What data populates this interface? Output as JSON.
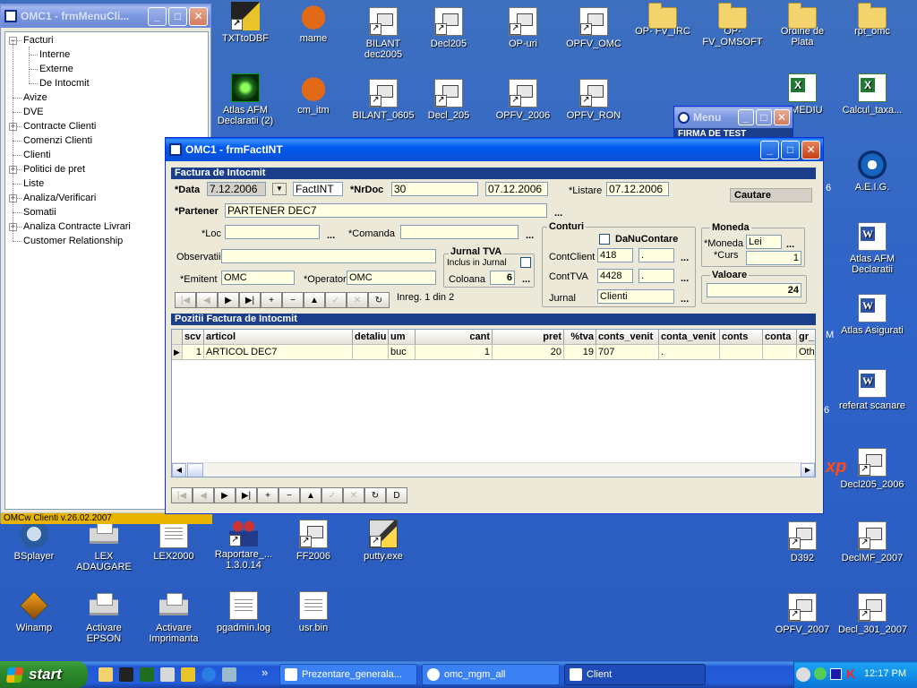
{
  "desktop": {
    "icons": [
      {
        "label": "TXTtoDBF",
        "type": "txt7"
      },
      {
        "label": "mame",
        "type": "fox"
      },
      {
        "label": "BILANT dec2005",
        "type": "flag"
      },
      {
        "label": "Decl205",
        "type": "flag"
      },
      {
        "label": "OP-uri",
        "type": "flag"
      },
      {
        "label": "OPFV_OMC",
        "type": "flag"
      },
      {
        "label": "OP- FV_IRC",
        "type": "folder"
      },
      {
        "label": "OP- FV_OMSOFT",
        "type": "folder"
      },
      {
        "label": "Ordine de Plata",
        "type": "folder"
      },
      {
        "label": "rpt_omc",
        "type": "folder"
      },
      {
        "label": "Atlas AFM Declaratii (2)",
        "type": "atlas"
      },
      {
        "label": "cm_itm",
        "type": "fox"
      },
      {
        "label": "BILANT_0605",
        "type": "flag"
      },
      {
        "label": "Decl_205",
        "type": "flag"
      },
      {
        "label": "OPFV_2006",
        "type": "flag"
      },
      {
        "label": "OPFV_RON",
        "type": "flag"
      },
      {
        "label": "A MEDIU",
        "type": "excel"
      },
      {
        "label": "Calcul_taxa...",
        "type": "excel"
      },
      {
        "label": "A.E.I.G.",
        "type": "gear"
      },
      {
        "label": "Atlas AFM Declaratii",
        "type": "word"
      },
      {
        "label": "Atlas Asigurati",
        "type": "word"
      },
      {
        "label": "referat scanare",
        "type": "word"
      },
      {
        "label": "Decl205_2006",
        "type": "flag"
      },
      {
        "label": "BSplayer",
        "type": "bs"
      },
      {
        "label": "LEX ADAUGARE",
        "type": "printer"
      },
      {
        "label": "LEX2000",
        "type": "doc"
      },
      {
        "label": "Raportare_... 1.3.0.14",
        "type": "people"
      },
      {
        "label": "FF2006",
        "type": "flag"
      },
      {
        "label": "putty.exe",
        "type": "putty"
      },
      {
        "label": "D392",
        "type": "flag"
      },
      {
        "label": "DeclMF_2007",
        "type": "flag"
      },
      {
        "label": "Winamp",
        "type": "winamp"
      },
      {
        "label": "Activare EPSON",
        "type": "printer"
      },
      {
        "label": "Activare Imprimanta",
        "type": "printer"
      },
      {
        "label": "pgadmin.log",
        "type": "doc"
      },
      {
        "label": "usr.bin",
        "type": "doc"
      },
      {
        "label": "OPFV_2007",
        "type": "flag"
      },
      {
        "label": "Decl_301_2007",
        "type": "flag"
      }
    ],
    "partial_fragments": {
      "six_a": "6",
      "six_b": "6",
      "m": "M",
      "xp": "xp"
    }
  },
  "menu_window": {
    "title": "OMC1 - frmMenuCli...",
    "tree": [
      {
        "label": "Facturi",
        "expander": "−"
      },
      {
        "label": "Interne"
      },
      {
        "label": "Externe"
      },
      {
        "label": "De Intocmit"
      },
      {
        "label": "Avize"
      },
      {
        "label": "DVE"
      },
      {
        "label": "Contracte Clienti",
        "expander": "+"
      },
      {
        "label": "Comenzi Clienti"
      },
      {
        "label": "Clienti"
      },
      {
        "label": "Politici de pret",
        "expander": "+"
      },
      {
        "label": "Liste"
      },
      {
        "label": "Analiza/Verificari",
        "expander": "+"
      },
      {
        "label": "Somatii"
      },
      {
        "label": "Analiza Contracte Livrari",
        "expander": "+"
      },
      {
        "label": "Customer Relationship"
      }
    ],
    "status": "OMCw Clienti v.26.02.2007"
  },
  "mini_menu": {
    "title": "Menu",
    "strip": "FIRMA DE TEST"
  },
  "form_window": {
    "title": "OMC1 - frmFactINT",
    "section_header": "Factura de Intocmit",
    "data_label": "*Data",
    "data_value": "7.12.2006",
    "dropdown_glyph": "▼",
    "doc_type": "FactINT",
    "nrdoc_label": "*NrDoc",
    "nrdoc_value": "30",
    "nrdoc_date": "07.12.2006",
    "listare_label": "*Listare",
    "listare_value": "07.12.2006",
    "cautare": "Cautare",
    "partener_label": "*Partener",
    "partener_value": "PARTENER DEC7",
    "loc_label": "*Loc",
    "loc_value": "",
    "comanda_label": "*Comanda",
    "comanda_value": "",
    "observatii_label": "Observatii",
    "observatii_value": "",
    "emitent_label": "*Emitent",
    "emitent_value": "OMC",
    "operator_label": "*Operator",
    "operator_value": "OMC",
    "ellipsis": "...",
    "jurnal_tva": {
      "title": "Jurnal TVA",
      "inclus_label": "Inclus in Jurnal",
      "coloana_label": "Coloana",
      "coloana_value": "6"
    },
    "conturi": {
      "title": "Conturi",
      "danucontare": "DaNuContare",
      "contclient_label": "ContClient",
      "contclient_value": "418",
      "contclient_sub": ".",
      "conttva_label": "ContTVA",
      "conttva_value": "4428",
      "conttva_sub": ".",
      "jurnal_label": "Jurnal",
      "jurnal_value": "Clienti"
    },
    "moneda": {
      "title": "Moneda",
      "moneda_label": "*Moneda",
      "moneda_value": "Lei",
      "curs_label": "*Curs",
      "curs_value": "1"
    },
    "valoare": {
      "title": "Valoare",
      "value": "24"
    },
    "nav_top": {
      "icons": [
        "|◀",
        "◀",
        "▶",
        "▶|",
        "+",
        "−",
        "▲",
        "✓",
        "✕",
        "↻"
      ],
      "record_text": "Inreg. 1 din 2"
    },
    "pozitii_header": "Pozitii Factura de Intocmit",
    "grid": {
      "columns": [
        "",
        "scv",
        "articol",
        "detaliu",
        "um",
        "cant",
        "pret",
        "%tva",
        "conts_venit",
        "conta_venit",
        "conts",
        "conta",
        "gr_"
      ],
      "rows": [
        [
          "▶",
          "1",
          "ARTICOL DEC7",
          "",
          "buc",
          "1",
          "20",
          "19",
          "707",
          ".",
          "",
          "",
          "Oth"
        ]
      ]
    },
    "nav_bottom": {
      "icons": [
        "|◀",
        "◀",
        "▶",
        "▶|",
        "+",
        "−",
        "▲",
        "✓",
        "✕",
        "↻",
        "D"
      ]
    }
  },
  "taskbar": {
    "start": "start",
    "tasks": [
      "Prezentare_generala...",
      "omc_mgm_all",
      "Client"
    ],
    "clock": "12:17 PM",
    "chevron": "»"
  }
}
